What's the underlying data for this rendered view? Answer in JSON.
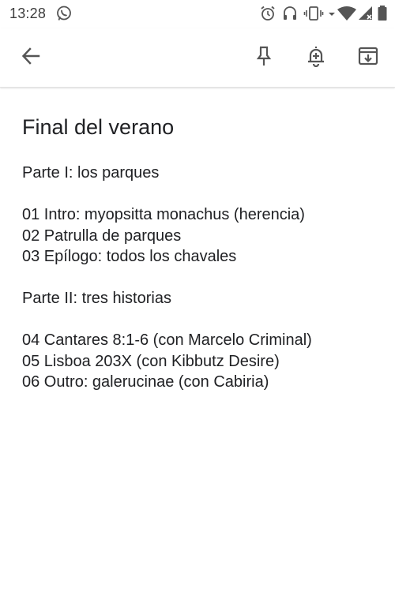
{
  "status_bar": {
    "time": "13:28",
    "icons": [
      "whatsapp-icon",
      "alarm-icon",
      "headset-icon",
      "vibrate-icon",
      "data-arrows-icon",
      "wifi-icon",
      "signal-icon",
      "battery-icon"
    ]
  },
  "toolbar": {
    "icons": [
      "back-arrow-icon",
      "pin-icon",
      "reminder-icon",
      "archive-icon"
    ]
  },
  "note": {
    "title": "Final del verano",
    "lines": [
      "Parte I: los parques",
      "",
      "01 Intro: myopsitta monachus (herencia)",
      "02 Patrulla de parques",
      "03 Epílogo: todos los chavales",
      "",
      "Parte II: tres historias",
      "",
      "04 Cantares 8:1-6 (con Marcelo Criminal)",
      "05 Lisboa 203X (con Kibbutz Desire)",
      "06 Outro: galerucinae (con Cabiria)"
    ]
  }
}
